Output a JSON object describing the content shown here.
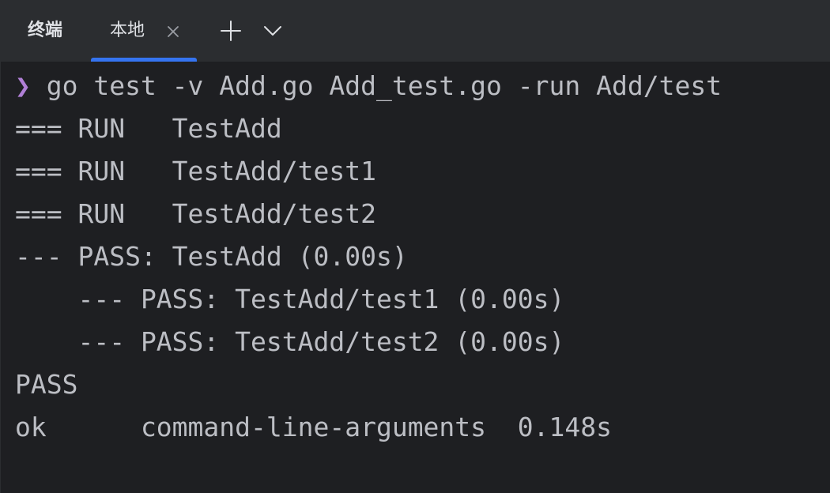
{
  "tool_window": {
    "title": "终端"
  },
  "tabs": [
    {
      "label": "本地",
      "active": true
    }
  ],
  "icons": {
    "close": "close-icon",
    "add": "plus-icon",
    "dropdown": "chevron-down-icon",
    "prompt": "chevron-right-icon"
  },
  "colors": {
    "background": "#1e1f22",
    "tabbar": "#2b2d30",
    "accent": "#3574f0",
    "text": "#bcbec4",
    "prompt": "#b07fd6"
  },
  "terminal": {
    "prompt_symbol": "❯",
    "command": " go test -v Add.go Add_test.go -run Add/test",
    "output": [
      "=== RUN   TestAdd",
      "=== RUN   TestAdd/test1",
      "=== RUN   TestAdd/test2",
      "--- PASS: TestAdd (0.00s)",
      "    --- PASS: TestAdd/test1 (0.00s)",
      "    --- PASS: TestAdd/test2 (0.00s)",
      "PASS",
      "ok      command-line-arguments  0.148s"
    ]
  }
}
